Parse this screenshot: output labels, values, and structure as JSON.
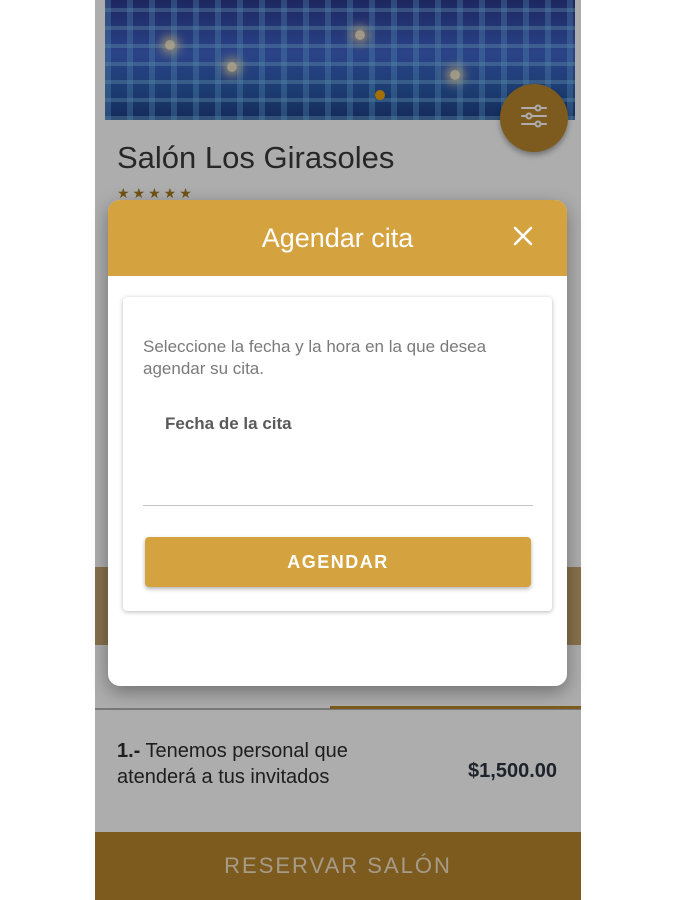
{
  "venue": {
    "name": "Salón Los Girasoles",
    "stars": "★★★★★",
    "rating": 5
  },
  "amenity": {
    "number": "1.-",
    "text": "Tenemos personal que atenderá a tus invitados",
    "price": "$1,500.00"
  },
  "footer": {
    "reserve_label": "RESERVAR SALÓN"
  },
  "dialog": {
    "title": "Agendar cita",
    "close_icon": "close-icon",
    "instructions": "Seleccione la fecha y la hora en la que desea agendar su cita.",
    "date_label": "Fecha de la cita",
    "date_value": "",
    "submit_label": "AGENDAR"
  },
  "icons": {
    "filter": "sliders-icon",
    "close": "close-icon"
  },
  "colors": {
    "accent": "#d4a33f",
    "accent_dark": "#b8862d",
    "text_dark": "#3a3a3a",
    "text_muted": "#7a7a7a"
  }
}
